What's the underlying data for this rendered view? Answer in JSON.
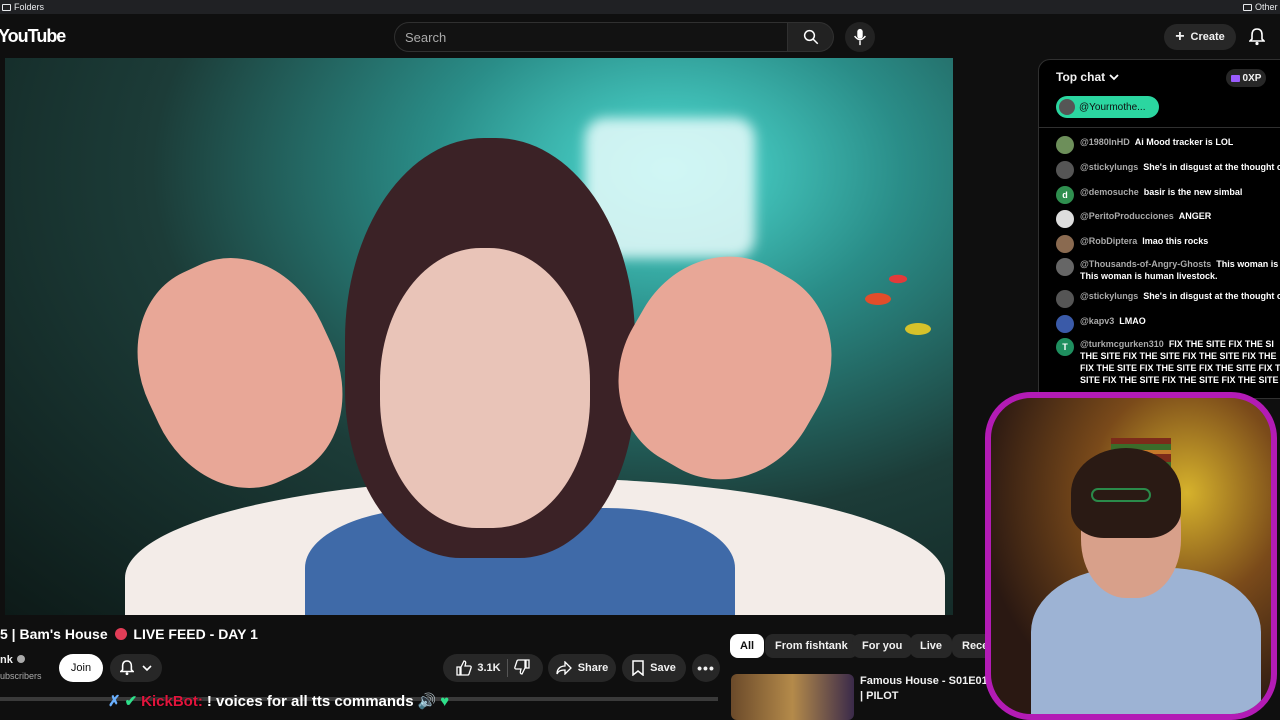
{
  "bookmarks": {
    "left": "Folders",
    "right": "Other"
  },
  "header": {
    "logo": "YouTube",
    "search_placeholder": "Search",
    "create_label": "Create"
  },
  "video": {
    "title_prefix": "5 | Bam's House",
    "title_suffix": "LIVE FEED - DAY 1",
    "channel": "nk",
    "subscribers": "ubscribers",
    "join_label": "Join",
    "likes": "3.1K",
    "share_label": "Share",
    "save_label": "Save"
  },
  "chips": [
    "All",
    "From fishtank",
    "For you",
    "Live",
    "Rece"
  ],
  "recommendation": {
    "title": "Famous House - S01E01 | PILOT"
  },
  "chat": {
    "header": "Top chat",
    "xp_label": "0XP",
    "pinned_user": "@Yourmothe...",
    "messages": [
      {
        "avatar": "",
        "author": "@1980InHD",
        "text": "Ai Mood tracker is LOL",
        "color": "#6d8f5a"
      },
      {
        "avatar": "",
        "author": "@stickylungs",
        "text": "She's in disgust at the thought o",
        "color": "#555555"
      },
      {
        "avatar": "d",
        "author": "@demosuche",
        "text": "basir is the new simbal",
        "color": "#2f8f4f"
      },
      {
        "avatar": "",
        "author": "@PeritoProducciones",
        "text": "ANGER",
        "color": "#dddddd"
      },
      {
        "avatar": "",
        "author": "@RobDiptera",
        "text": "lmao this rocks",
        "color": "#8a6a50"
      },
      {
        "avatar": "",
        "author": "@Thousands-of-Angry-Ghosts",
        "text": "This woman is",
        "line2": "This woman is human livestock.",
        "color": "#666666"
      },
      {
        "avatar": "",
        "author": "@stickylungs",
        "text": "She's in disgust at the thought o",
        "color": "#555555"
      },
      {
        "avatar": "",
        "author": "@kapv3",
        "text": "LMAO",
        "color": "#3a5aa8"
      },
      {
        "avatar": "T",
        "author": "@turkmcgurken310",
        "text": "FIX THE SITE FIX THE SI",
        "line2": "THE SITE FIX THE SITE FIX THE SITE FIX THE",
        "line3": "FIX THE SITE FIX THE SITE FIX THE SITE FIX T",
        "line4": "SITE FIX THE SITE FIX THE SITE FIX THE SITE",
        "color": "#1f8f5f"
      }
    ]
  },
  "ticker": {
    "bot": "KickBot:",
    "text": "! voices for all tts commands"
  }
}
